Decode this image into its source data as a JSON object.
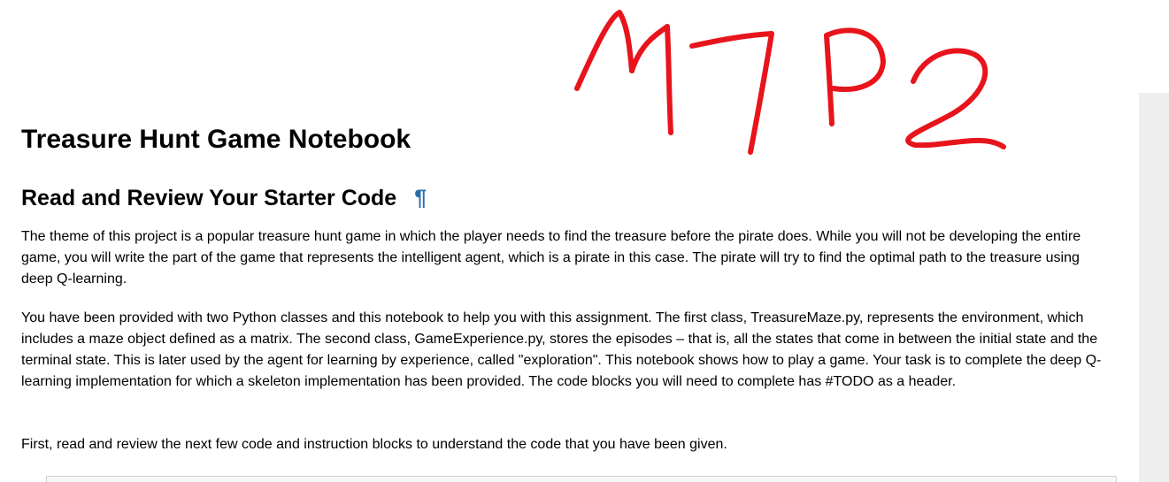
{
  "notebook": {
    "title": "Treasure Hunt Game Notebook",
    "section_heading": "Read and Review Your Starter Code",
    "anchor_symbol": "¶",
    "paragraphs": [
      "The theme of this project is a popular treasure hunt game in which the player needs to find the treasure before the pirate does. While you will not be developing the entire game, you will write the part of the game that represents the intelligent agent, which is a pirate in this case. The pirate will try to find the optimal path to the treasure using deep Q-learning.",
      "You have been provided with two Python classes and this notebook to help you with this assignment. The first class, TreasureMaze.py, represents the environment, which includes a maze object defined as a matrix. The second class, GameExperience.py, stores the episodes – that is, all the states that come in between the initial state and the terminal state. This is later used by the agent for learning by experience, called \"exploration\". This notebook shows how to play a game. Your task is to complete the deep Q-learning implementation for which a skeleton implementation has been provided. The code blocks you will need to complete has #TODO as a header.",
      "First, read and review the next few code and instruction blocks to understand the code that you have been given."
    ]
  },
  "annotation": {
    "handwritten_text": "M7P2",
    "color": "#e8141c"
  },
  "colors": {
    "anchor_link": "#296eaa",
    "gutter": "#eeeeee"
  }
}
